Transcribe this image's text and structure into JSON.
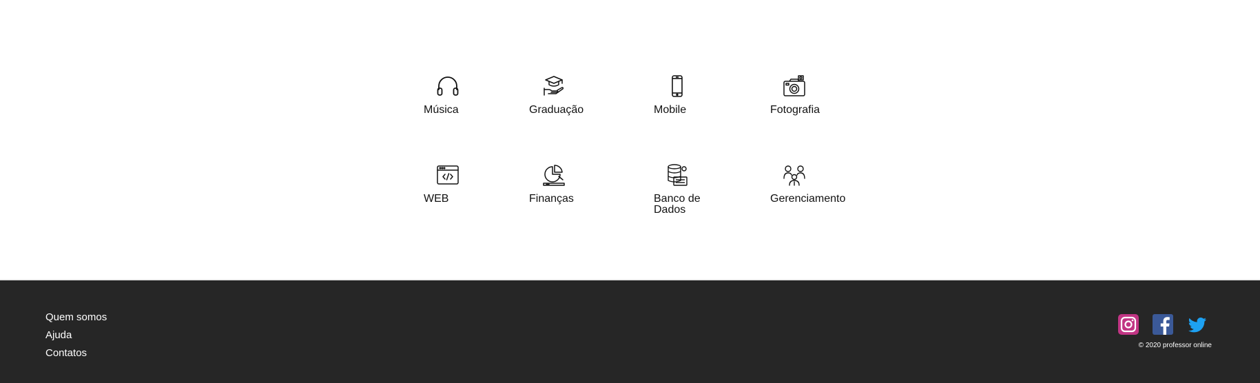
{
  "categories": [
    {
      "label": "Música",
      "icon": "headphones-icon"
    },
    {
      "label": "Graduação",
      "icon": "graduation-cap-icon"
    },
    {
      "label": "Mobile",
      "icon": "smartphone-icon"
    },
    {
      "label": "Fotografia",
      "icon": "camera-icon"
    },
    {
      "label": "WEB",
      "icon": "code-window-icon"
    },
    {
      "label": "Finanças",
      "icon": "pie-chart-icon"
    },
    {
      "label": "Banco de Dados",
      "icon": "database-icon"
    },
    {
      "label": "Gerenciamento",
      "icon": "team-icon"
    }
  ],
  "footer": {
    "links": [
      "Quem somos",
      "Ajuda",
      "Contatos"
    ],
    "social": [
      "instagram-icon",
      "facebook-icon",
      "twitter-icon"
    ],
    "copyright": "© 2020 professor online"
  },
  "colors": {
    "footer_bg": "#262626",
    "instagram": "#c13584",
    "facebook": "#3b5998",
    "twitter": "#1da1f2"
  }
}
